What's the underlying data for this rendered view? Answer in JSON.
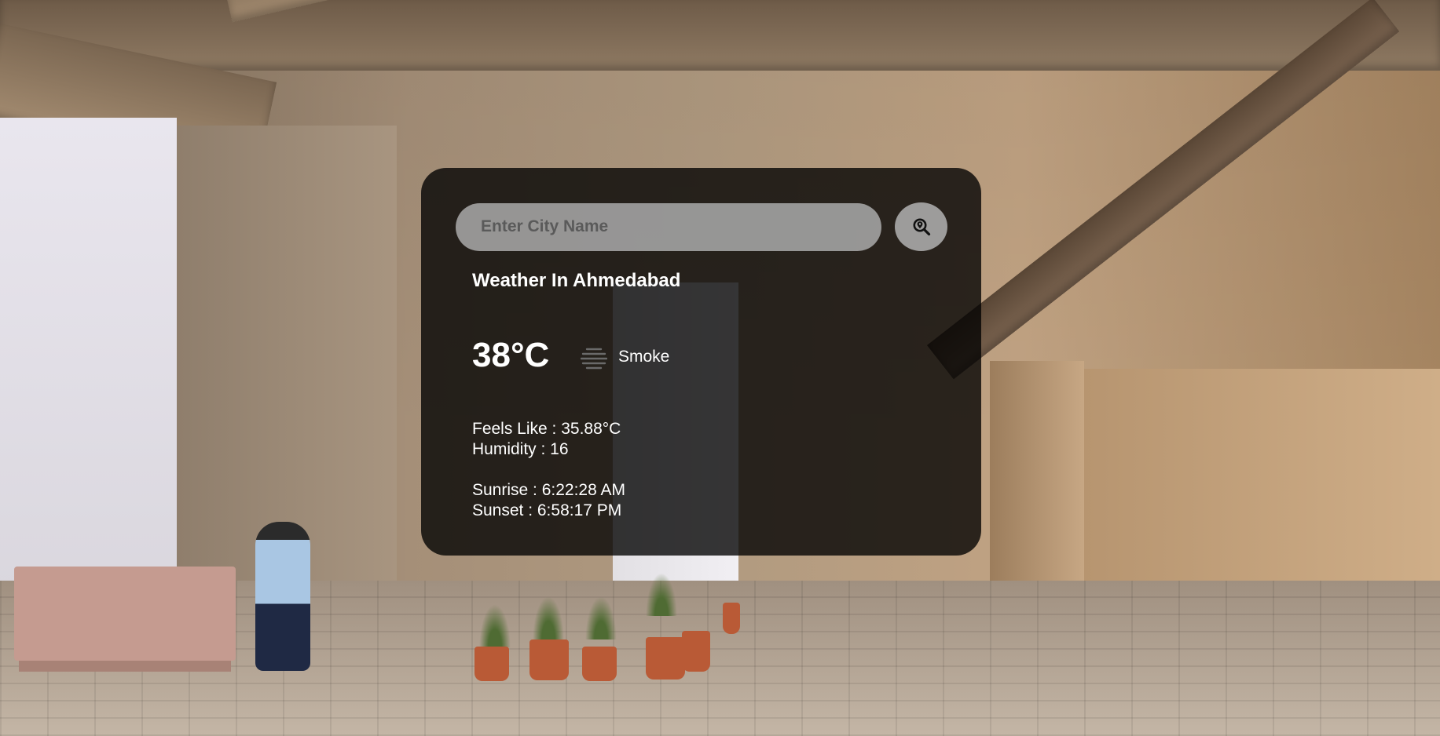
{
  "search": {
    "placeholder": "Enter City Name",
    "value": ""
  },
  "weather": {
    "title": "Weather In Ahmedabad",
    "temperature": "38°C",
    "condition": "Smoke",
    "condition_icon": "smoke-haze-icon",
    "feels_like": "Feels Like : 35.88°C",
    "humidity": "Humidity : 16",
    "sunrise": "Sunrise : 6:22:28 AM",
    "sunset": "Sunset : 6:58:17 PM"
  },
  "icons": {
    "search_button": "map-pin-search-icon"
  },
  "colors": {
    "card_background": "#000000c7",
    "input_background": "#aaaaaa",
    "text": "#ffffff"
  }
}
